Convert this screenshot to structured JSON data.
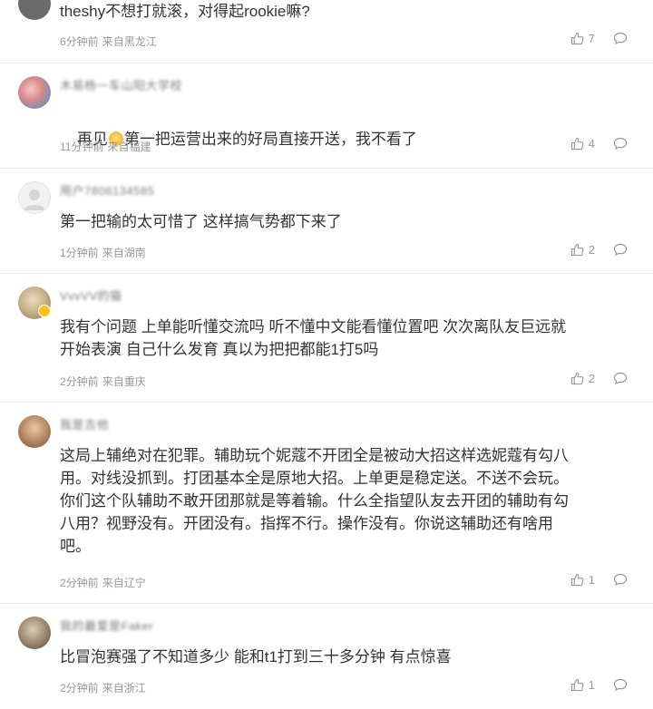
{
  "comments": [
    {
      "username": "",
      "text": "theshy不想打就滚，对得起rookie嘛?",
      "time": "6分钟前",
      "location": "来自黑龙江",
      "likes": "7"
    },
    {
      "username": "木易杨一车山阳大学校",
      "text_before": "再见",
      "text_after": "第一把运营出来的好局直接开送，我不看了",
      "time": "11分钟前",
      "location": "来自福建",
      "likes": "4"
    },
    {
      "username": "用户7806134585",
      "text": "第一把输的太可惜了 这样搞气势都下来了",
      "time": "1分钟前",
      "location": "来自湖南",
      "likes": "2"
    },
    {
      "username": "VvvVV的猫",
      "text": "我有个问题 上单能听懂交流吗 听不懂中文能看懂位置吧 次次离队友巨远就\n开始表演 自己什么发育 真以为把把都能1打5吗",
      "time": "2分钟前",
      "location": "来自重庆",
      "likes": "2"
    },
    {
      "username": "我是吉他",
      "text": "这局上辅绝对在犯罪。辅助玩个妮蔻不开团全是被动大招这样选妮蔻有勾八\n用。对线没抓到。打团基本全是原地大招。上单更是稳定送。不送不会玩。\n你们这个队辅助不敢开团那就是等着输。什么全指望队友去开团的辅助有勾\n八用？视野没有。开团没有。指挥不行。操作没有。你说这辅助还有啥用\n吧。",
      "time": "2分钟前",
      "location": "来自辽宁",
      "likes": "1"
    },
    {
      "username": "我的最爱是Faker",
      "text": "比冒泡赛强了不知道多少 能和t1打到三十多分钟 有点惊喜",
      "time": "2分钟前",
      "location": "来自浙江",
      "likes": "1"
    }
  ]
}
